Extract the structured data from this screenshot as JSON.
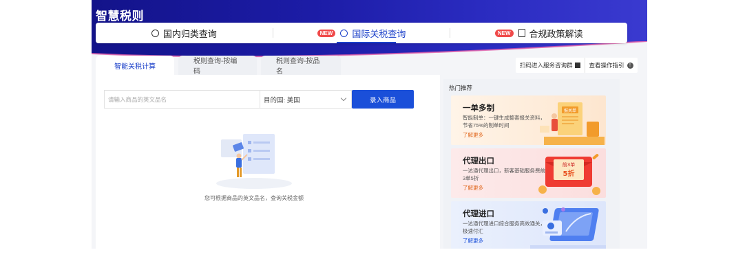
{
  "brand": "智慧税则",
  "topnav": [
    {
      "label": "国内归类查询",
      "badge": ""
    },
    {
      "label": "国际关税查询",
      "badge": "NEW",
      "active": true
    },
    {
      "label": "合规政策解读",
      "badge": "NEW"
    }
  ],
  "tabs": [
    {
      "label": "智能关税计算",
      "active": true
    },
    {
      "label": "税则查询-按编码"
    },
    {
      "label": "税则查询-按品名"
    }
  ],
  "guide": {
    "scan": "扫码进入服务咨询群",
    "help": "查看操作指引"
  },
  "search": {
    "placeholder": "请输入商品的英文品名",
    "dest_label": "目的国:",
    "dest_value": "美国",
    "button": "录入商品"
  },
  "empty_text": "您可根据商品的英文品名，查询关税金额",
  "side": {
    "title": "热门推荐",
    "cards": [
      {
        "title": "一单多制",
        "desc": "智能制单：一键生成整套报关资料，节省75%的制单时间",
        "more": "了解更多",
        "tag": "报关单"
      },
      {
        "title": "代理出口",
        "desc": "一达通代理出口，新客基础服务费前3单5折",
        "more": "了解更多",
        "tag1": "前3单",
        "tag2": "5折"
      },
      {
        "title": "代理进口",
        "desc": "一达通代理进口综合服务高效通关，极速付汇",
        "more": "了解更多"
      }
    ]
  },
  "colors": {
    "primary": "#1a4fd9",
    "brand_bg": "#1c1ca6",
    "badge": "#f04a4a"
  }
}
